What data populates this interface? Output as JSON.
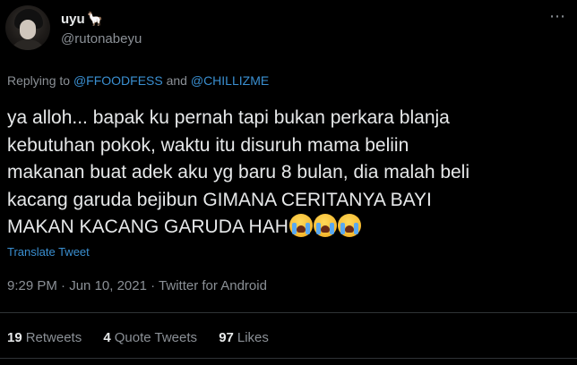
{
  "author": {
    "display_name": "uyu",
    "name_emoji": "🦙",
    "handle": "@rutonabeyu"
  },
  "more_icon": "⋯",
  "reply_context": {
    "prefix": "Replying to",
    "mention_1": "@FFOODFESS",
    "joiner": "and",
    "mention_2": "@CHILLIZME"
  },
  "tweet": {
    "text": "ya alloh... bapak ku pernah tapi bukan perkara blanja\nkebutuhan pokok, waktu itu disuruh mama beliin\nmakanan buat adek aku yg baru 8 bulan, dia malah beli\nkacang garuda bejibun GIMANA CERITANYA BAYI\nMAKAN KACANG GARUDA HAH",
    "trailing_emoji": [
      "loudly-crying-face-icon",
      "loudly-crying-face-icon",
      "loudly-crying-face-icon"
    ]
  },
  "translate_label": "Translate Tweet",
  "meta": {
    "time": "9:29 PM",
    "date": "Jun 10, 2021",
    "source": "Twitter for Android",
    "separator": "·"
  },
  "stats": [
    {
      "count": "19",
      "label": "Retweets"
    },
    {
      "count": "4",
      "label": "Quote Tweets"
    },
    {
      "count": "97",
      "label": "Likes"
    }
  ],
  "colors": {
    "background": "#000000",
    "text": "#e7e9ea",
    "secondary": "#8b9096",
    "link": "#3a8fd1",
    "divider": "#2f3336"
  }
}
